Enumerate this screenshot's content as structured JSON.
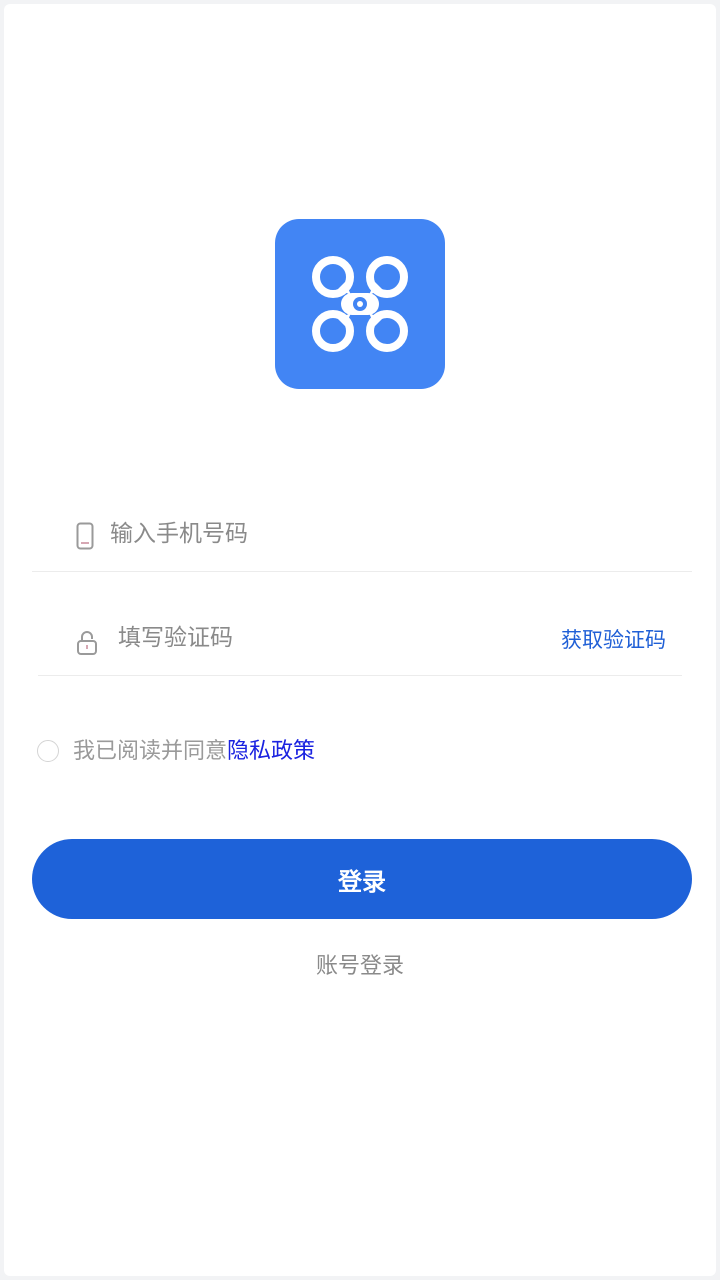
{
  "logo": {
    "icon": "drone-icon",
    "bg_color": "#4285f4"
  },
  "phone_field": {
    "icon": "phone-icon",
    "placeholder": "输入手机号码",
    "value": ""
  },
  "code_field": {
    "icon": "lock-icon",
    "placeholder": "填写验证码",
    "value": "",
    "get_code_label": "获取验证码"
  },
  "agreement": {
    "text": "我已阅读并同意",
    "link_label": "隐私政策",
    "checked": false
  },
  "login_button": {
    "label": "登录",
    "color": "#1e62d9"
  },
  "account_login": {
    "label": "账号登录"
  }
}
